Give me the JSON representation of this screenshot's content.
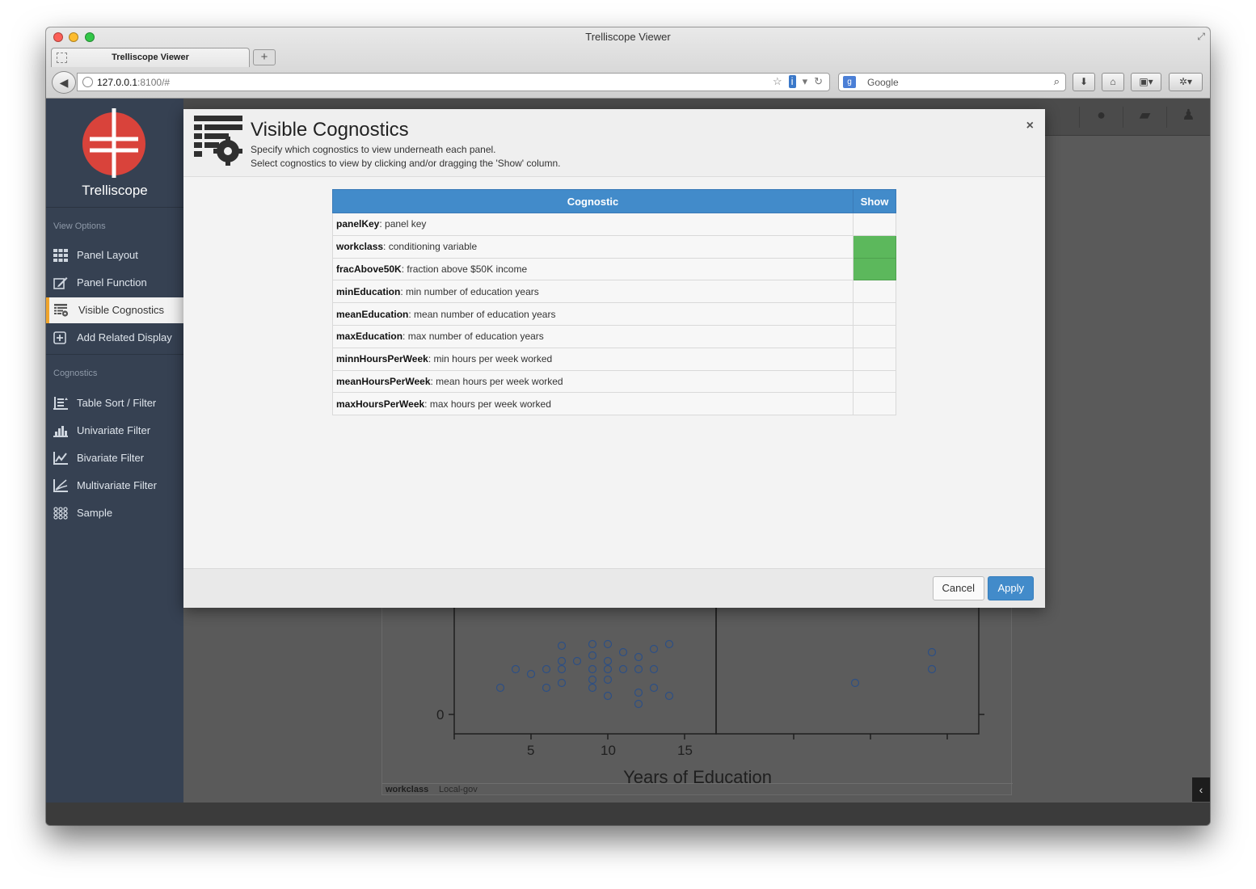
{
  "browser": {
    "window_title": "Trelliscope Viewer",
    "tab_label": "Trelliscope Viewer",
    "new_tab": "+",
    "url_host": "127.0.0.1",
    "url_rest": ":8100/#",
    "search_placeholder": "Google"
  },
  "app": {
    "logo_title": "Trelliscope",
    "sidebar": {
      "view_options_heading": "View Options",
      "view_options": [
        {
          "label": "Panel Layout",
          "icon": "grid-icon"
        },
        {
          "label": "Panel Function",
          "icon": "edit-icon"
        },
        {
          "label": "Visible Cognostics",
          "icon": "table-gear-icon",
          "active": true
        },
        {
          "label": "Add Related Display",
          "icon": "plus-square-icon"
        }
      ],
      "cognostics_heading": "Cognostics",
      "cognostics": [
        {
          "label": "Table Sort / Filter",
          "icon": "table-sort-icon"
        },
        {
          "label": "Univariate Filter",
          "icon": "histogram-icon"
        },
        {
          "label": "Bivariate Filter",
          "icon": "line-chart-icon"
        },
        {
          "label": "Multivariate Filter",
          "icon": "scatter-icon"
        },
        {
          "label": "Sample",
          "icon": "dots-grid-icon"
        }
      ]
    },
    "accent_color": "#f0a52d"
  },
  "modal": {
    "title": "Visible Cognostics",
    "subtitle_line1": "Specify which cognostics to view underneath each panel.",
    "subtitle_line2": "Select cognostics to view by clicking and/or dragging the 'Show' column.",
    "close_symbol": "×",
    "table": {
      "col_cognostic": "Cognostic",
      "col_show": "Show",
      "rows": [
        {
          "name": "panelKey",
          "desc": ": panel key",
          "show": false
        },
        {
          "name": "workclass",
          "desc": ": conditioning variable",
          "show": true
        },
        {
          "name": "fracAbove50K",
          "desc": ": fraction above $50K income",
          "show": true
        },
        {
          "name": "minEducation",
          "desc": ": min number of education years",
          "show": false
        },
        {
          "name": "meanEducation",
          "desc": ": mean number of education years",
          "show": false
        },
        {
          "name": "maxEducation",
          "desc": ": max number of education years",
          "show": false
        },
        {
          "name": "minnHoursPerWeek",
          "desc": ": min hours per week worked",
          "show": false
        },
        {
          "name": "meanHoursPerWeek",
          "desc": ": mean hours per week worked",
          "show": false
        },
        {
          "name": "maxHoursPerWeek",
          "desc": ": max hours per week worked",
          "show": false
        }
      ]
    },
    "cancel_label": "Cancel",
    "apply_label": "Apply",
    "show_on_color": "#5cb85c",
    "header_color": "#428bca"
  },
  "background_panel": {
    "y_tick": "0",
    "x_ticks": [
      "5",
      "10",
      "15"
    ],
    "x_label": "Years of Education",
    "strip_name": "workclass",
    "strip_value": "Local-gov"
  }
}
